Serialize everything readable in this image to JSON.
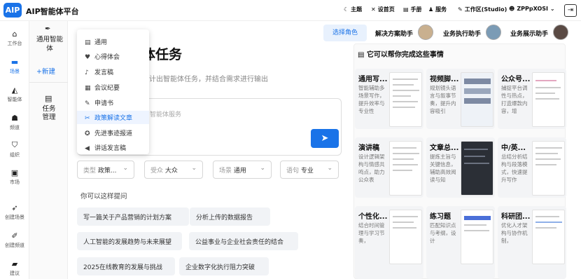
{
  "app": {
    "logo": "AIP",
    "title": "AIP智能体平台"
  },
  "topnav": [
    {
      "icon": "moon-icon",
      "glyph": "☾",
      "label": "主题"
    },
    {
      "icon": "wrench-icon",
      "glyph": "✕",
      "label": "设首页"
    },
    {
      "icon": "book-icon",
      "glyph": "▤",
      "label": "手册"
    },
    {
      "icon": "users-icon",
      "glyph": "♟",
      "label": "服务"
    },
    {
      "icon": "pen-icon",
      "glyph": "✎",
      "label": "工作区(Studio)"
    },
    {
      "icon": "user-icon",
      "glyph": "☻",
      "label": "ZPPpXOSI"
    }
  ],
  "sidebar": [
    {
      "icon": "home-icon",
      "glyph": "⌂",
      "label": "工作台"
    },
    {
      "icon": "box-icon",
      "glyph": "▬",
      "label": "场景"
    },
    {
      "icon": "sail-icon",
      "glyph": "◭",
      "label": "智能体"
    },
    {
      "icon": "group-icon",
      "glyph": "☗",
      "label": "频道"
    },
    {
      "icon": "org-icon",
      "glyph": "⛉",
      "label": "组织"
    },
    {
      "icon": "market-icon",
      "glyph": "▣",
      "label": "市场"
    },
    {
      "icon": "send-icon",
      "glyph": "➶",
      "label": "创建场景"
    },
    {
      "icon": "brush-icon",
      "glyph": "✐",
      "label": "创建频道"
    },
    {
      "icon": "chat-icon",
      "glyph": "▰",
      "label": "建议"
    }
  ],
  "subnav": {
    "general": "通用智能体",
    "new": "+新建",
    "task": "任务管理"
  },
  "roles": {
    "select_button": "选择角色",
    "items": [
      "解决方案助手",
      "业务执行助手",
      "业务展示助手"
    ]
  },
  "main": {
    "title_tail": "体任务",
    "subtitle_tail": "计出智能体任务，并结合需求进行输出",
    "input_placeholder": "智能体服务",
    "filters": [
      {
        "label": "类型",
        "value": "政策..."
      },
      {
        "label": "受众",
        "value": "大众"
      },
      {
        "label": "场景",
        "value": "通用"
      },
      {
        "label": "语句",
        "value": "专业"
      }
    ],
    "suggest_title": "你可以这样提问",
    "chips": [
      "写一篇关于产品营销的计划方案",
      "分析上传的数据报告",
      "人工智能的发展趋势与未来展望",
      "公益事业与企业社会责任的结合",
      "2025在线教育的发展与挑战",
      "企业数字化执行阻力突破"
    ]
  },
  "dropdown": {
    "items": [
      {
        "icon": "doc-icon",
        "glyph": "▤",
        "label": "通用"
      },
      {
        "icon": "heart-icon",
        "glyph": "♥",
        "label": "心得体会"
      },
      {
        "icon": "mic-icon",
        "glyph": "♪",
        "label": "发言稿"
      },
      {
        "icon": "calendar-icon",
        "glyph": "▦",
        "label": "会议纪要"
      },
      {
        "icon": "file-edit-icon",
        "glyph": "✎",
        "label": "申请书"
      },
      {
        "icon": "tools-icon",
        "glyph": "✂",
        "label": "政策解读文章"
      },
      {
        "icon": "medal-icon",
        "glyph": "✪",
        "label": "先进事迹报道"
      },
      {
        "icon": "megaphone-icon",
        "glyph": "◀",
        "label": "讲话发言稿"
      }
    ],
    "selected_index": 5
  },
  "right": {
    "title": "它可以帮你完成这些事情",
    "tiles": [
      {
        "title": "通用写...",
        "desc": "智能辅助多场景写作，提升效率与专业性"
      },
      {
        "title": "视频脚...",
        "desc": "规划镜头语言与叙事节奏，提升内容吸引"
      },
      {
        "title": "公众号...",
        "desc": "捕捉平台调性与热点，打造爆款内容，增"
      },
      {
        "title": "演讲稿",
        "desc": "设计逻辑架构与情感共鸣点，助力公众表"
      },
      {
        "title": "文章总...",
        "desc": "提炼主旨与关键信息，辅助高效阅读与知"
      },
      {
        "title": "中/英...",
        "desc": "总结分析结构与段落模式，快速提升写作"
      },
      {
        "title": "个性化...",
        "desc": "结合时间管理与学习节奏，"
      },
      {
        "title": "练习题",
        "desc": "匹配知识点与考纲，设计"
      },
      {
        "title": "科研团...",
        "desc": "优化人才架构与协作机制，"
      }
    ]
  },
  "colors": {
    "accent": "#1a73e8"
  }
}
